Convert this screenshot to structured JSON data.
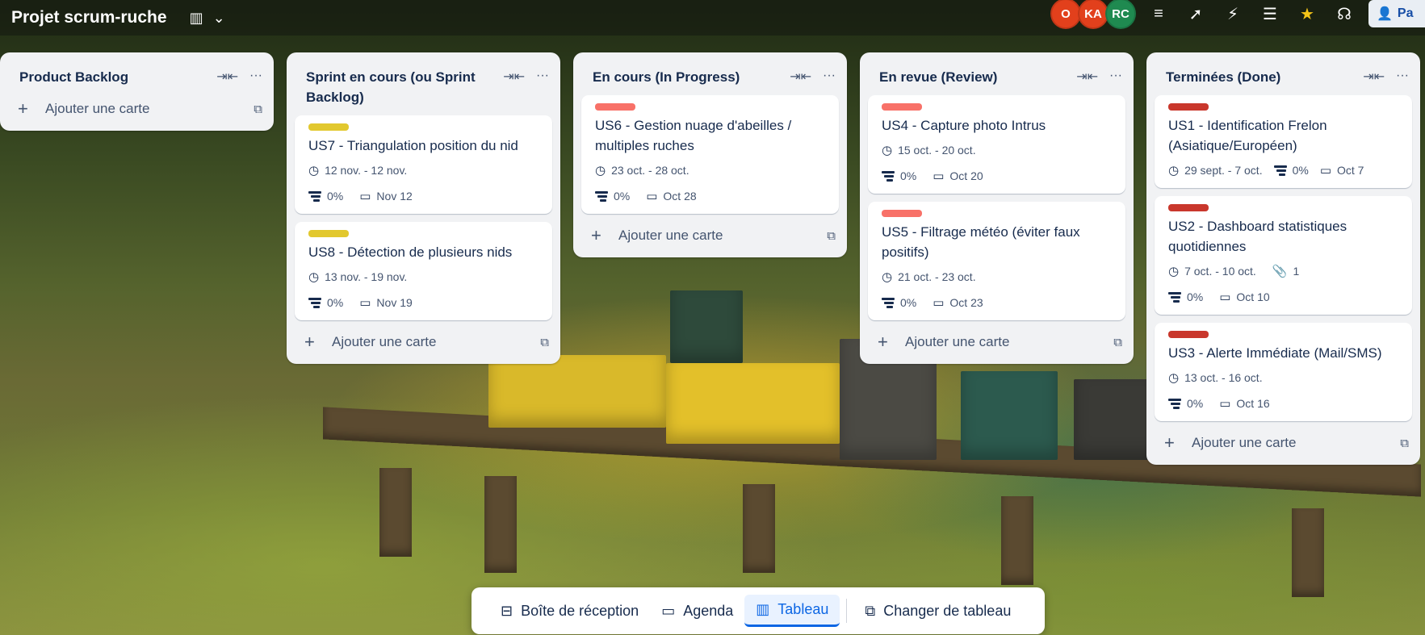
{
  "header": {
    "board_title": "Projet scrum-ruche",
    "avatars": [
      {
        "initials": "O",
        "color": "#e2401c"
      },
      {
        "initials": "KA",
        "color": "#e2401c"
      },
      {
        "initials": "RC",
        "color": "#1f8a50"
      }
    ],
    "share_label": "Pa"
  },
  "lists": [
    {
      "title": "Product Backlog",
      "cards": [],
      "add_label": "Ajouter une carte"
    },
    {
      "title": "Sprint en cours (ou Sprint Backlog)",
      "cards": [
        {
          "label_color": "#e2c82e",
          "title": "US7 - Triangulation position du nid",
          "dates": "12 nov. - 12 nov.",
          "checklist": "0%",
          "due": "Nov 12"
        },
        {
          "label_color": "#e2c82e",
          "title": "US8 - Détection de plusieurs nids",
          "dates": "13 nov. - 19 nov.",
          "checklist": "0%",
          "due": "Nov 19"
        }
      ],
      "add_label": "Ajouter une carte"
    },
    {
      "title": "En cours (In Progress)",
      "cards": [
        {
          "label_color": "#f87168",
          "title": "US6 - Gestion nuage d'abeilles / multiples ruches",
          "dates": "23 oct. - 28 oct.",
          "checklist": "0%",
          "due": "Oct 28"
        }
      ],
      "add_label": "Ajouter une carte"
    },
    {
      "title": "En revue (Review)",
      "cards": [
        {
          "label_color": "#f87168",
          "title": "US4 - Capture photo Intrus",
          "dates": "15 oct. - 20 oct.",
          "checklist": "0%",
          "due": "Oct 20"
        },
        {
          "label_color": "#f87168",
          "title": "US5 - Filtrage météo (éviter faux positifs)",
          "dates": "21 oct. - 23 oct.",
          "checklist": "0%",
          "due": "Oct 23"
        }
      ],
      "add_label": "Ajouter une carte"
    },
    {
      "title": "Terminées (Done)",
      "cards": [
        {
          "label_color": "#c9372c",
          "title": "US1 - Identification Frelon (Asiatique/Européen)",
          "dates": "29 sept. - 7 oct.",
          "checklist": "0%",
          "due": "Oct 7"
        },
        {
          "label_color": "#c9372c",
          "title": "US2 - Dashboard statistiques quotidiennes",
          "dates": "7 oct. - 10 oct.",
          "attachments": "1",
          "checklist": "0%",
          "due": "Oct 10"
        },
        {
          "label_color": "#c9372c",
          "title": "US3 - Alerte Immédiate (Mail/SMS)",
          "dates": "13 oct. - 16 oct.",
          "checklist": "0%",
          "due": "Oct 16"
        }
      ],
      "add_label": "Ajouter une carte"
    }
  ],
  "bottom_nav": {
    "inbox": "Boîte de réception",
    "planner": "Agenda",
    "board": "Tableau",
    "switch": "Changer de tableau"
  }
}
